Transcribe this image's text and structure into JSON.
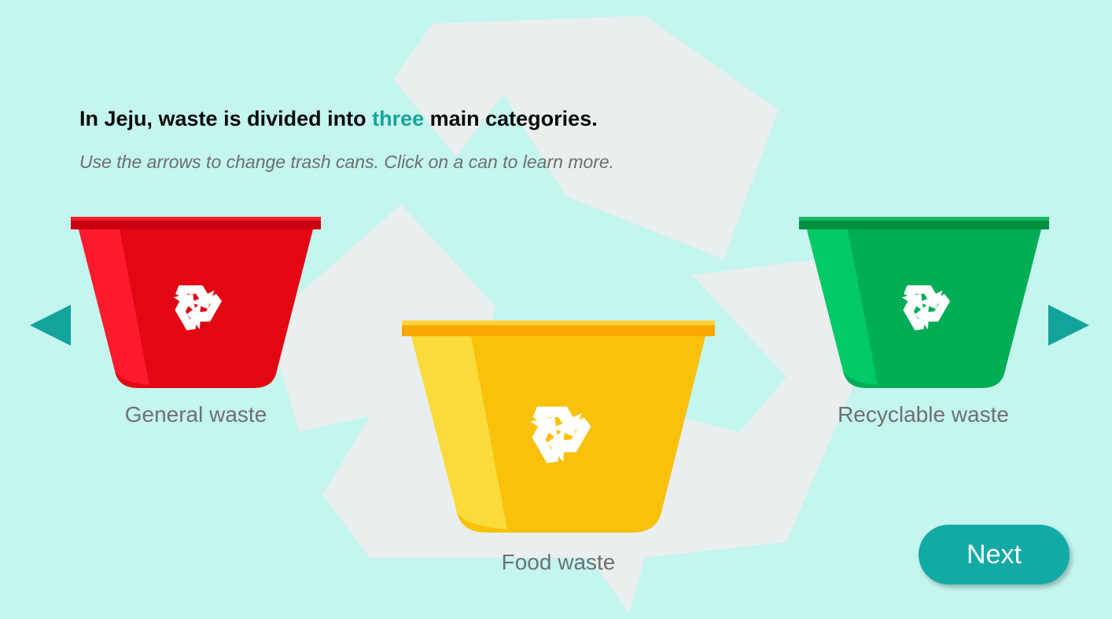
{
  "intro": {
    "heading_before": "In Jeju, waste is divided into ",
    "heading_accent": "three",
    "heading_after": " main categories.",
    "instructions": "Use the arrows to change trash cans. Click on a can to learn more."
  },
  "cans": [
    {
      "label": "General waste",
      "color": "#e30613"
    },
    {
      "label": "Food waste",
      "color": "#f9c10b"
    },
    {
      "label": "Recyclable waste",
      "color": "#00ad55"
    }
  ],
  "icons": {
    "previous": "left-arrow-icon",
    "next": "right-arrow-icon",
    "can_symbol": "recycle-icon",
    "background": "recycle-background-icon"
  },
  "colors": {
    "background": "#c4f5ef",
    "accent": "#19a59a",
    "button": "#12aaa4"
  },
  "footer": {
    "next_label": "Next"
  }
}
